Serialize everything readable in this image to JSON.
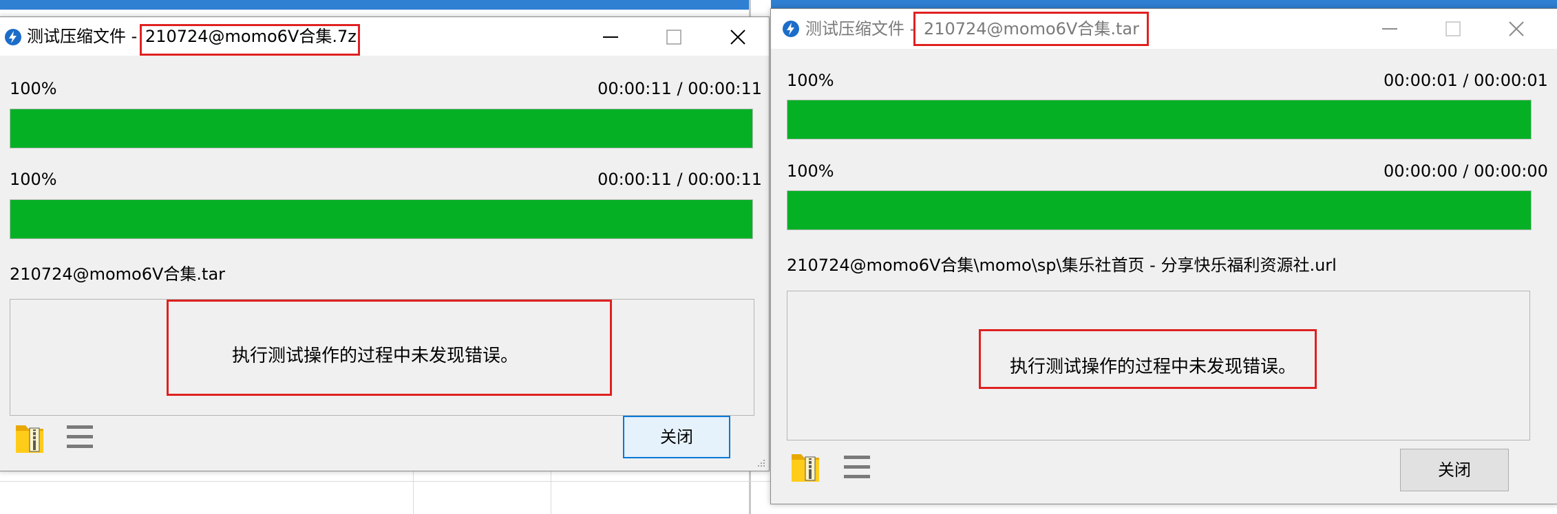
{
  "windows": [
    {
      "title_prefix": "测试压缩文件 - ",
      "archive_name": "210724@momo6V合集.7z",
      "progress": [
        {
          "percent_label": "100%",
          "time_label": "00:00:11 / 00:00:11",
          "fraction": 1.0
        },
        {
          "percent_label": "100%",
          "time_label": "00:00:11 / 00:00:11",
          "fraction": 1.0
        }
      ],
      "current_file": "210724@momo6V合集.tar",
      "message": "执行测试操作的过程中未发现错误。",
      "close_label": "关闭"
    },
    {
      "title_prefix": "测试压缩文件 - ",
      "archive_name": "210724@momo6V合集.tar",
      "progress": [
        {
          "percent_label": "100%",
          "time_label": "00:00:01 / 00:00:01",
          "fraction": 1.0
        },
        {
          "percent_label": "100%",
          "time_label": "00:00:00 / 00:00:00",
          "fraction": 1.0
        }
      ],
      "current_file": "210724@momo6V合集\\momo\\sp\\集乐社首页 - 分享快乐福利资源社.url",
      "message": "执行测试操作的过程中未发现错误。",
      "close_label": "关闭"
    }
  ],
  "colors": {
    "progress_fill": "#06b025",
    "highlight_box": "#e02020",
    "focus_border": "#0078d7"
  },
  "icons": [
    "app-icon",
    "minimize-icon",
    "maximize-icon",
    "close-icon",
    "archive-folder-icon",
    "menu-icon",
    "resize-grip-icon"
  ]
}
